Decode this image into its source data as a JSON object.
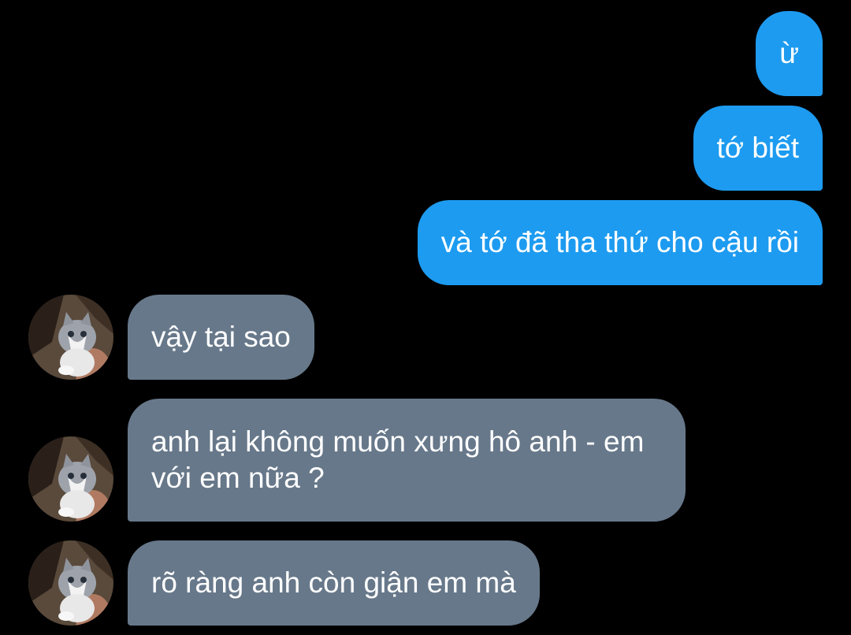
{
  "conversation": {
    "sent_messages": [
      {
        "text": "ừ"
      },
      {
        "text": "tớ biết"
      },
      {
        "text": "và tớ đã tha thứ cho cậu rồi"
      }
    ],
    "received_messages": [
      {
        "text": "vậy tại sao"
      },
      {
        "text": "anh lại không muốn xưng hô anh - em với em nữa ?"
      },
      {
        "text": "rõ ràng anh còn giận em mà"
      }
    ]
  },
  "colors": {
    "background": "#000000",
    "sent_bubble": "#1d9bf0",
    "received_bubble": "#67788a",
    "text": "#ffffff"
  },
  "icons": {
    "avatar": "cat-avatar-icon"
  }
}
